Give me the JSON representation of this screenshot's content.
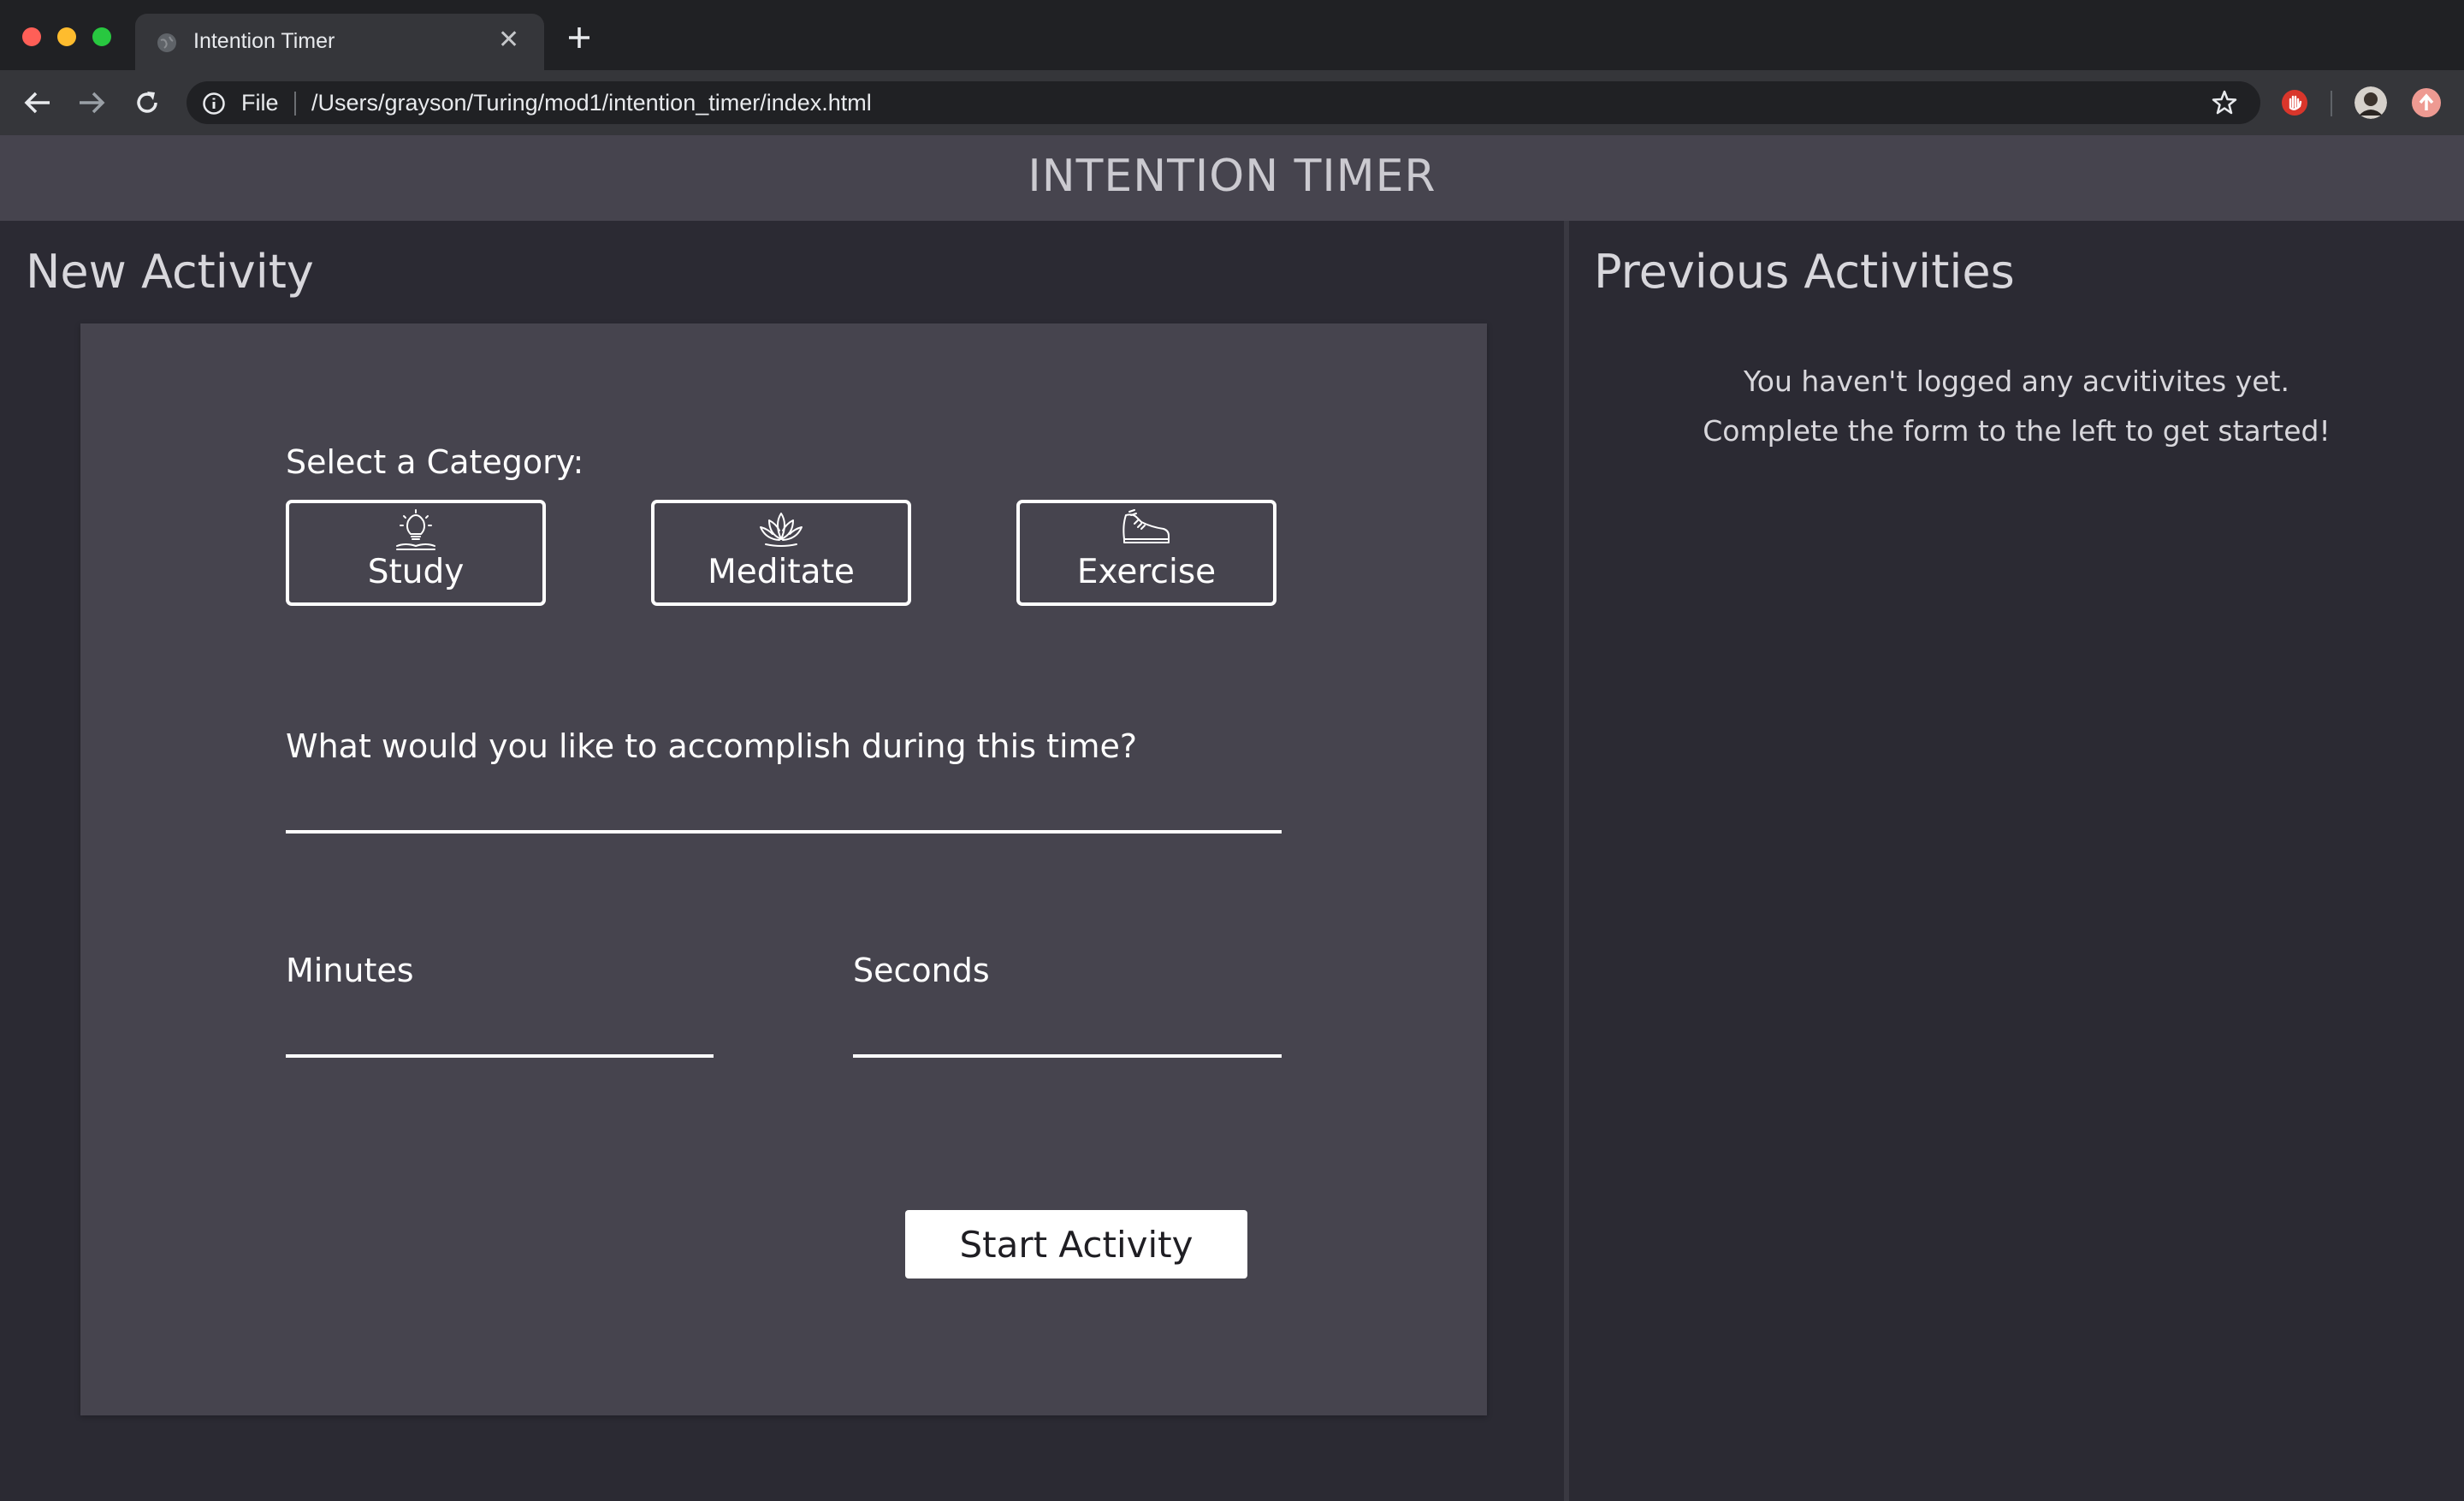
{
  "browser": {
    "tab_title": "Intention Timer",
    "tab_close": "✕",
    "new_tab": "+",
    "scheme": "File",
    "url": "/Users/grayson/Turing/mod1/intention_timer/index.html"
  },
  "app": {
    "title": "INTENTION TIMER"
  },
  "new_activity": {
    "heading": "New Activity",
    "category_label": "Select a Category:",
    "categories": [
      {
        "label": "Study",
        "icon": "lightbulb-icon"
      },
      {
        "label": "Meditate",
        "icon": "lotus-icon"
      },
      {
        "label": "Exercise",
        "icon": "sneaker-icon"
      }
    ],
    "description_label": "What would you like to accomplish during this time?",
    "description_value": "",
    "minutes_label": "Minutes",
    "minutes_value": "",
    "seconds_label": "Seconds",
    "seconds_value": "",
    "start_label": "Start Activity"
  },
  "previous_activities": {
    "heading": "Previous Activities",
    "empty_line1": "You haven't logged any acvitivites yet.",
    "empty_line2": "Complete the form to the left to get started!"
  }
}
